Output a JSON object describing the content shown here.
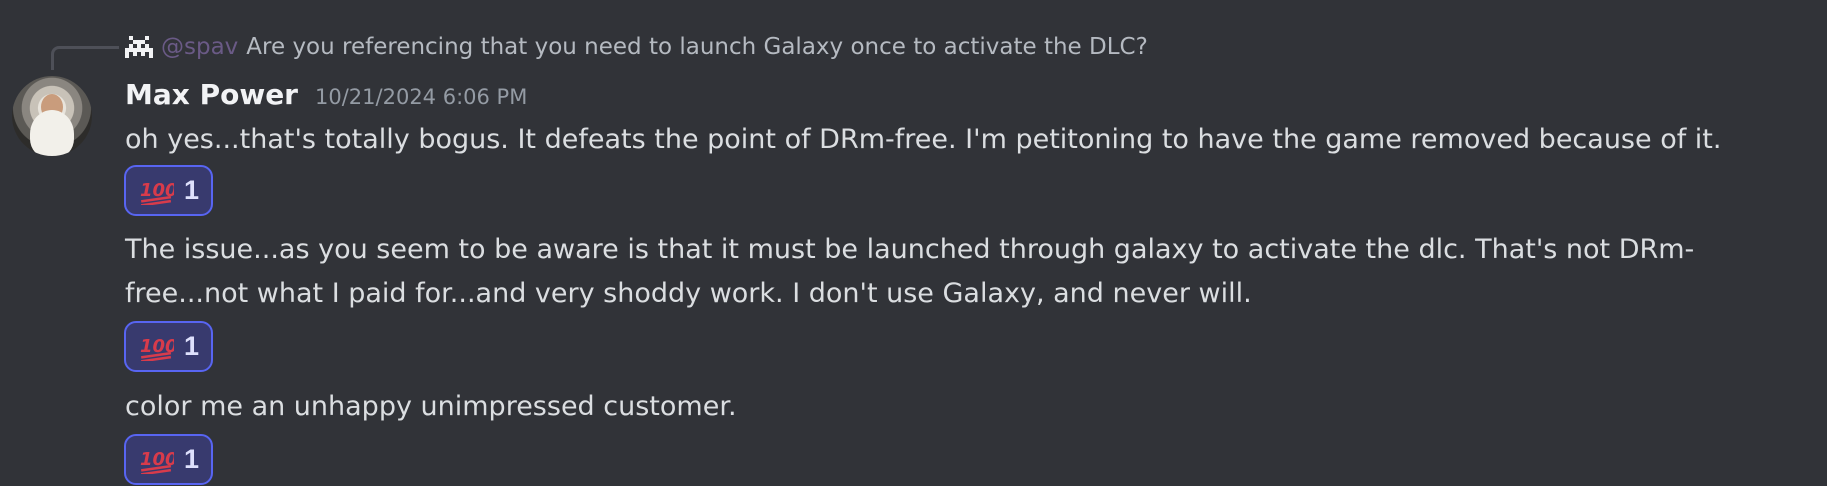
{
  "reply": {
    "mention": "@spav",
    "text": "Are you referencing that you need to launch Galaxy once to activate the DLC?"
  },
  "message": {
    "author": "Max Power",
    "timestamp": "10/21/2024 6:06 PM"
  },
  "messages": [
    {
      "text": "oh yes...that's totally bogus.  It defeats the point of DRm-free.  I'm petitoning to have the game removed because of it.",
      "reaction": {
        "emoji": "hundred-points",
        "count": "1"
      }
    },
    {
      "line1": "The issue...as you seem to be aware is that it must be launched through galaxy to activate the dlc.  That's not DRm-",
      "line2": "free...not what I paid for...and very shoddy work.  I don't use Galaxy, and never will.",
      "reaction": {
        "emoji": "hundred-points",
        "count": "1"
      }
    },
    {
      "text": "color me an unhappy unimpressed customer.",
      "reaction": {
        "emoji": "hundred-points",
        "count": "1"
      }
    }
  ],
  "colors": {
    "background": "#313338",
    "reaction_border": "#5865f2",
    "reaction_fill": "#383a6e",
    "emoji_red": "#d83b4b"
  }
}
